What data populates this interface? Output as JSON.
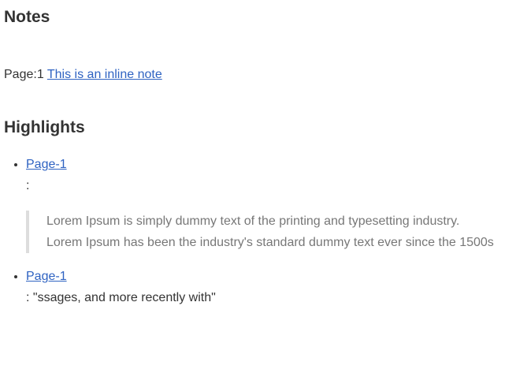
{
  "notes": {
    "title": "Notes",
    "page_label": "Page:1",
    "inline_note_link": "This is an inline note"
  },
  "highlights": {
    "title": "Highlights",
    "items": [
      {
        "link": "Page-1",
        "suffix": ":",
        "quote": "Lorem Ipsum is simply dummy text of the printing and typesetting industry. Lorem Ipsum has been the industry's standard dummy text ever since the 1500s"
      },
      {
        "link": "Page-1",
        "suffix": ": \"ssages, and more recently with\""
      }
    ]
  }
}
